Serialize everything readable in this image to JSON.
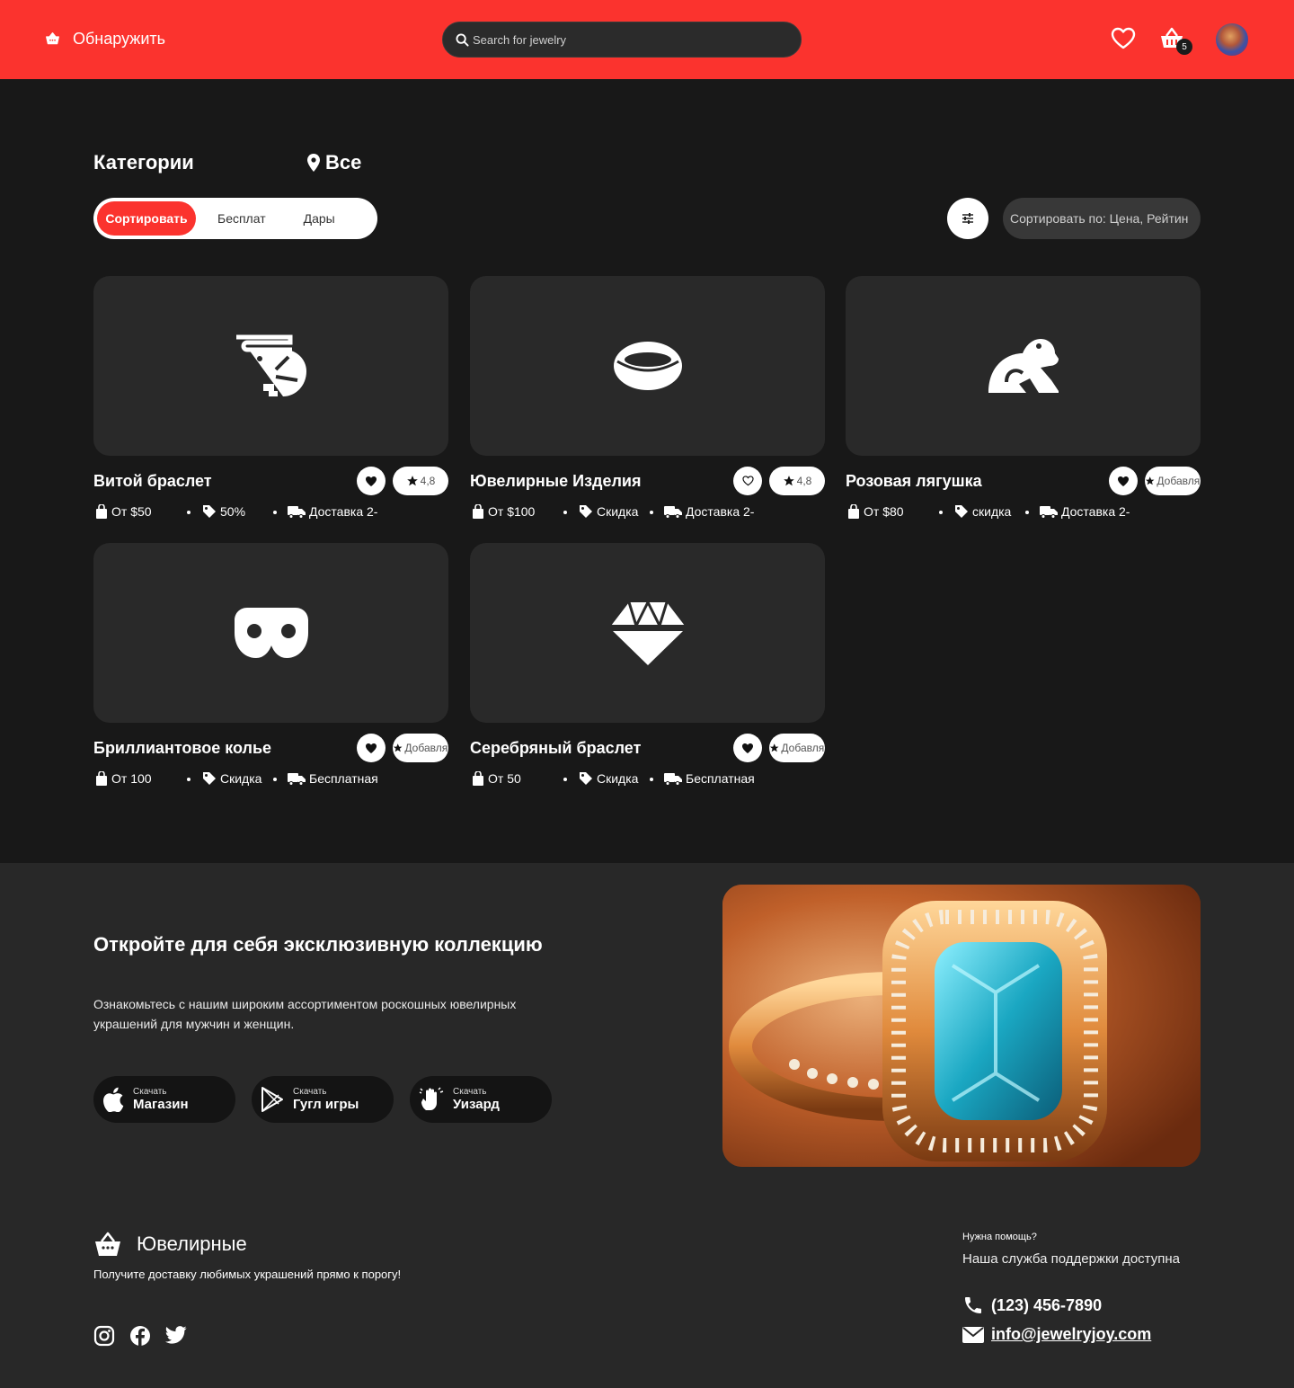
{
  "header": {
    "brand": "Обнаружить",
    "search_placeholder": "Search for jewelry",
    "cart_count": "5"
  },
  "categories": {
    "title": "Категории",
    "location": "Все",
    "tabs": [
      "Сортировать",
      "Бесплат",
      "Дары"
    ],
    "sort_label": "Сортировать по: Цена, Рейтин"
  },
  "products": [
    {
      "name": "Витой браслет",
      "icon": "shrimp-icon",
      "rating": "4,8",
      "price": "От $50",
      "discount": "50%",
      "delivery": "Доставка 2-"
    },
    {
      "name": "Ювелирные Изделия",
      "icon": "ring-icon",
      "rating": "4,8",
      "price": "От $100",
      "discount": "Скидка",
      "delivery": "Доставка 2-"
    },
    {
      "name": "Розовая лягушка",
      "icon": "frog-icon",
      "rating": "Добавлять",
      "price": "От $80",
      "discount": "скидка",
      "delivery": "Доставка 2-"
    },
    {
      "name": "Бриллиантовое колье",
      "icon": "mask-icon",
      "rating": "Добавлять",
      "price": "От 100",
      "discount": "Скидка",
      "delivery": "Бесплатная"
    },
    {
      "name": "Серебряный браслет",
      "icon": "diamond-icon",
      "rating": "Добавлять",
      "price": "От 50",
      "discount": "Скидка",
      "delivery": "Бесплатная"
    }
  ],
  "promo": {
    "title": "Откройте для себя эксклюзивную коллекцию",
    "description": "Ознакомьтесь с нашим широким ассортиментом роскошных ювелирных украшений для мужчин и женщин.",
    "stores": [
      {
        "small": "Скачать",
        "big": "Магазин",
        "icon": "apple-icon"
      },
      {
        "small": "Скачать",
        "big": "Гугл игры",
        "icon": "google-play-icon"
      },
      {
        "small": "Скачать",
        "big": "Уизард",
        "icon": "hand-wizard-icon"
      }
    ]
  },
  "footer": {
    "brand": "Ювелирные",
    "tagline": "Получите доставку любимых украшений прямо к порогу!",
    "help_small": "Нужна помощь?",
    "help_big": "Наша служба поддержки доступна",
    "phone": "(123) 456-7890",
    "email": "info@jewelryjoy.com"
  },
  "colors": {
    "accent": "#fb332e",
    "background": "#181818",
    "card": "#292929",
    "promo_bg": "#282828"
  }
}
